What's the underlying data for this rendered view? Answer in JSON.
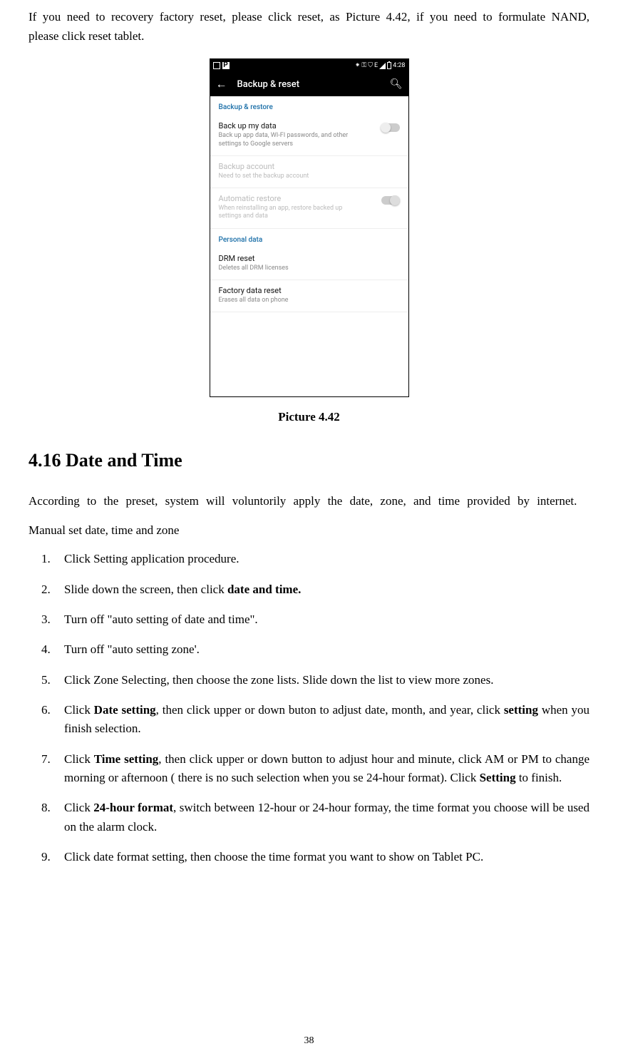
{
  "intro": "If you need to recovery factory reset, please click reset, as Picture 4.42, if you need to formulate NAND, please click reset tablet.",
  "screenshot": {
    "statusbar": {
      "letter": "P",
      "time": "4:28",
      "icon_e": "E"
    },
    "titlebar": {
      "title": "Backup & reset"
    },
    "section1_header": "Backup & restore",
    "backup_data": {
      "title": "Back up my data",
      "sub": "Back up app data, WI-FI passwords, and other settings to Google servers"
    },
    "backup_account": {
      "title": "Backup account",
      "sub": "Need to set the backup account"
    },
    "auto_restore": {
      "title": "Automatic restore",
      "sub": "When reinstalling an app, restore backed up settings and data"
    },
    "section2_header": "Personal data",
    "drm": {
      "title": "DRM reset",
      "sub": "Deletes all DRM licenses"
    },
    "factory": {
      "title": "Factory data reset",
      "sub": "Erases all data on phone"
    }
  },
  "caption": "Picture 4.42",
  "heading": "4.16 Date and Time",
  "para1": "According to the preset, system will voluntorily apply the date, zone, and time provided by internet.",
  "subhead": "Manual set date, time and zone",
  "steps": {
    "s1": "Click Setting application procedure.",
    "s2a": "Slide down the screen, then click ",
    "s2b": "date and time.",
    "s3": "Turn off \"auto setting of date and time\".",
    "s4": "Turn off \"auto setting zone'.",
    "s5": "Click Zone Selecting, then choose the zone lists. Slide down the list to view more zones.",
    "s6a": "Click ",
    "s6b": "Date setting",
    "s6c": ", then click upper or down buton to adjust date, month, and year, click ",
    "s6d": "setting",
    "s6e": " when you finish selection.",
    "s7a": "Click ",
    "s7b": "Time setting",
    "s7c": ", then click upper or down button to adjust hour and minute, click AM or PM to change morning or afternoon ( there is no such selection when you se 24-hour format). Click ",
    "s7d": "Setting",
    "s7e": " to finish.",
    "s8a": "Click ",
    "s8b": "24-hour format",
    "s8c": ", switch between 12-hour or 24-hour formay, the time format you choose will be used on the alarm clock.",
    "s9": "Click date format setting, then choose the time format you want to show on Tablet PC."
  },
  "pagenum": "38"
}
